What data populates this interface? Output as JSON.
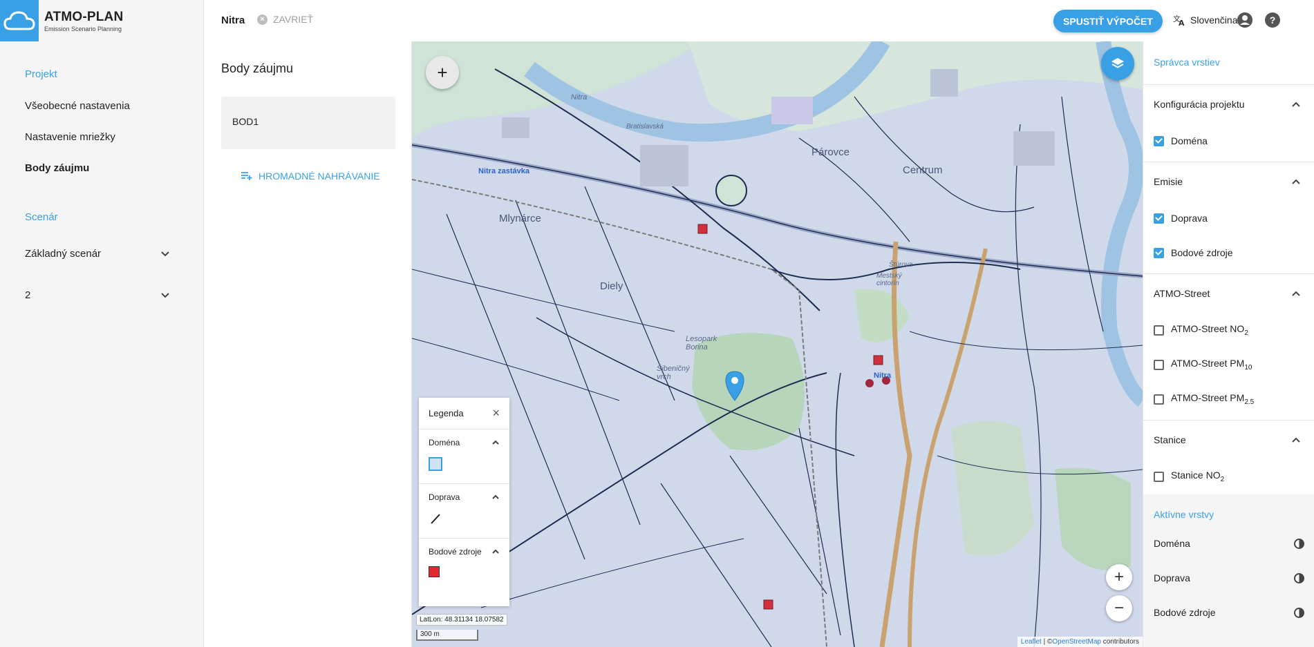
{
  "app": {
    "title": "ATMO-PLAN",
    "subtitle": "Emission Scenario Planning"
  },
  "sidebar": {
    "project_header": "Projekt",
    "project_items": [
      "Všeobecné nastavenia",
      "Nastavenie mriežky",
      "Body záujmu"
    ],
    "active_item": "Body záujmu",
    "scenario_header": "Scenár",
    "scenario_items": [
      "Základný scenár",
      "2"
    ]
  },
  "topbar": {
    "tab_label": "Nitra",
    "close_label": "ZAVRIEŤ",
    "run_button": "SPUSTIŤ VÝPOČET",
    "language": "Slovenčina"
  },
  "points_panel": {
    "title": "Body záujmu",
    "points": [
      "BOD1"
    ],
    "bulk_upload": "HROMADNÉ NAHRÁVANIE"
  },
  "map": {
    "labels": {
      "nitra_zastavka": "Nitra zastávka",
      "mlynarce": "Mlynárce",
      "diely": "Diely",
      "parovce": "Párovce",
      "centrum": "Centrum",
      "lesopark": "Lesopark Borina",
      "sibenicny": "Šibeničný vrch",
      "nitra_station": "Nitra",
      "mestsky_cintorin": "Mestský cintorín",
      "river": "Nitra",
      "bratislavska": "Bratislavská",
      "sturova": "Štúrova"
    },
    "latlon": "LatLon: 48.31134 18.07582",
    "scale": "300 m",
    "attribution_leaflet": "Leaflet",
    "attribution_sep": " | ©",
    "attribution_osm": "OpenStreetMap",
    "attribution_tail": " contributors",
    "colors": {
      "domain": "#3aa0e6",
      "traffic": "#222222",
      "point_source": "#e0282d",
      "marker": "#3aa0e6"
    }
  },
  "legend": {
    "title": "Legenda",
    "sections": [
      "Doména",
      "Doprava",
      "Bodové zdroje"
    ]
  },
  "layers_panel": {
    "title": "Správca vrstiev",
    "groups": [
      {
        "name": "Konfigurácia projektu",
        "items": [
          {
            "label": "Doména",
            "checked": true
          }
        ]
      },
      {
        "name": "Emisie",
        "items": [
          {
            "label": "Doprava",
            "checked": true
          },
          {
            "label": "Bodové zdroje",
            "checked": true
          }
        ]
      },
      {
        "name": "ATMO-Street",
        "items": [
          {
            "label": "ATMO-Street NO",
            "sub": "2",
            "checked": false
          },
          {
            "label": "ATMO-Street PM",
            "sub": "10",
            "checked": false
          },
          {
            "label": "ATMO-Street PM",
            "sub": "2.5",
            "checked": false
          }
        ]
      },
      {
        "name": "Stanice",
        "items": [
          {
            "label": "Stanice NO",
            "sub": "2",
            "checked": false
          }
        ]
      }
    ],
    "active_title": "Aktívne vrstvy",
    "active_layers": [
      "Doména",
      "Doprava",
      "Bodové zdroje"
    ]
  }
}
